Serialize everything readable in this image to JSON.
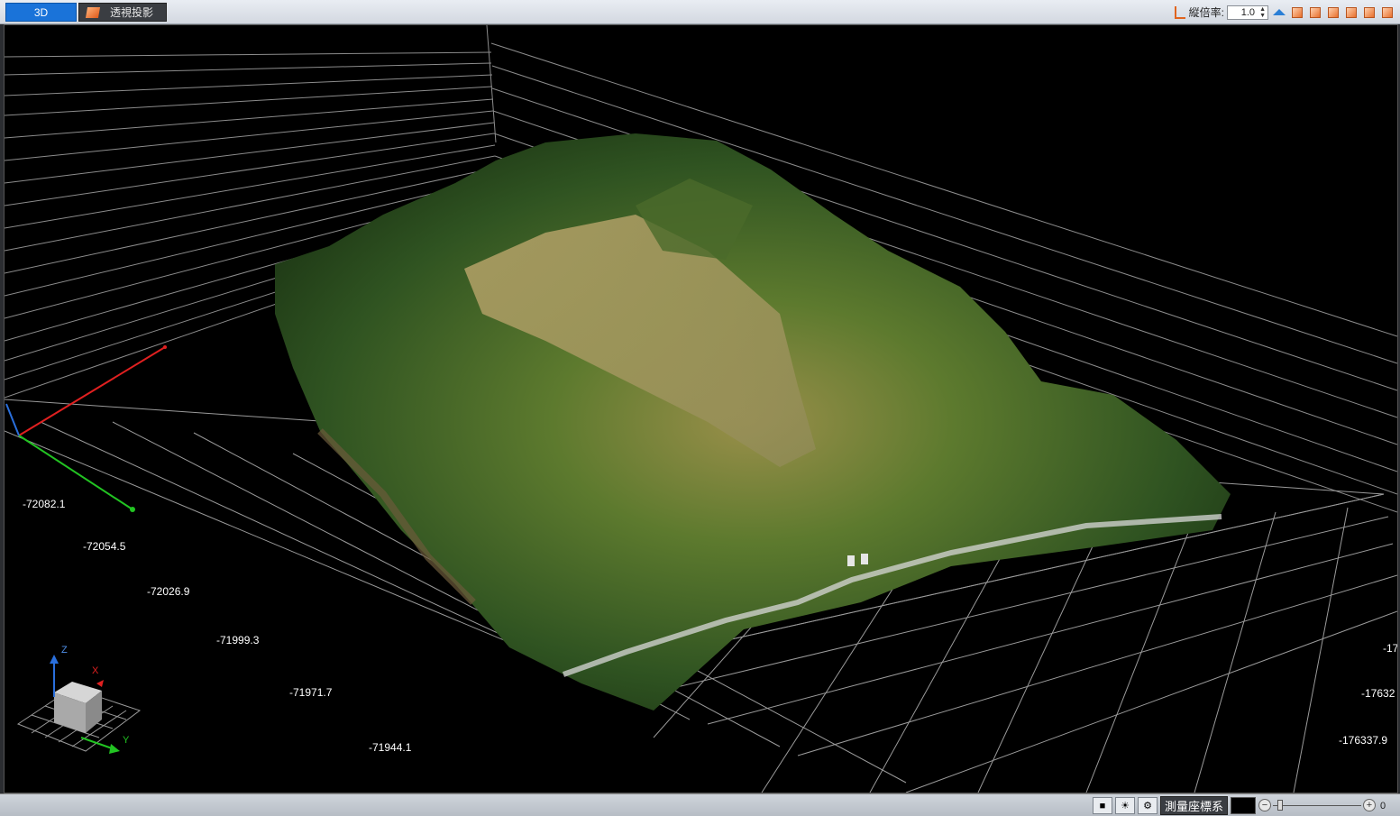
{
  "tabs": [
    {
      "label": "3D",
      "active": true
    },
    {
      "label": "透視投影",
      "active": false
    }
  ],
  "toolbar": {
    "exaggeration_label": "縦倍率:",
    "exaggeration_value": "1.0",
    "view_buttons": [
      "home-view-icon",
      "view-cube-icon-1",
      "view-cube-icon-2",
      "view-cube-icon-3",
      "view-cube-icon-4",
      "view-cube-icon-5",
      "view-cube-icon-6"
    ]
  },
  "viewport": {
    "x_labels": [
      "-72082.1",
      "-72054.5",
      "-72026.9",
      "-71999.3",
      "-71971.7",
      "-71944.1"
    ],
    "y_labels": [
      "-17",
      "-17632",
      "-176337.9"
    ]
  },
  "nav_cube": {
    "z": "Z",
    "x": "X",
    "y": "Y"
  },
  "statusbar": {
    "coordinate_system": "測量座標系",
    "zoom_value": "0",
    "zoom_fraction": 0.05
  },
  "colors": {
    "active_tab": "#1a73d9",
    "axis_x": "#e02020",
    "axis_y": "#22c322",
    "axis_z": "#2a6fdc"
  }
}
